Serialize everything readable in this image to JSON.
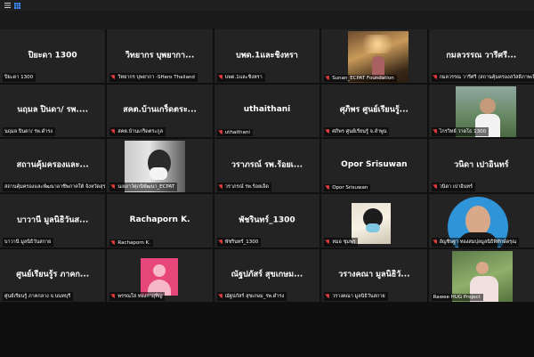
{
  "toolbar": {
    "menu_icon": "hamburger-icon",
    "grid_icon": "grid-view-icon",
    "accent": "#3b8cff"
  },
  "tiles": [
    {
      "name": "ปิยะดา 1300",
      "label": "ปิยะดา 1300",
      "muted": false
    },
    {
      "name": "วิทยากร บุพยากา...",
      "label": "วิทยากร บุพยากา -SHero Thailand",
      "muted": true
    },
    {
      "name": "บพด.1และชิงหรา",
      "label": "บพด.1และชิงหรา",
      "muted": true
    },
    {
      "name": "",
      "label": "Sunan_ECPAT Foundation",
      "muted": true,
      "video": "night"
    },
    {
      "name": "กมลวรรณ  วารีศรี...",
      "label": "กมลวรรณ  วารีศรี (สถานคุ้มครองสวัสดิภาพเป็น",
      "muted": true
    },
    {
      "name": "นฤมล ปินดา/ รพ....",
      "label": "นฤมล ปินดา/ รพ.ดำรง",
      "muted": false
    },
    {
      "name": "สคต.บ้านเกร็ดตระ...",
      "label": "สคต.บ้านเกร็ดตระกูล",
      "muted": true
    },
    {
      "name": "uthaithani",
      "label": "uthaithani",
      "muted": true
    },
    {
      "name": "ศุภิพร ศูนย์เรียนรู้...",
      "label": "ศภิพร ศูนย์เรียนรู้ จ.ลำพูน",
      "muted": true
    },
    {
      "name": "",
      "label": "ไกรวิทย์ วาดโธ 1300",
      "muted": true,
      "video": "forest"
    },
    {
      "name": "สถานคุ้มครองและ...",
      "label": "สถานคุ้มครองและพัฒนาอาชีพภาคใต้ จังหวัดสุราษ",
      "muted": false
    },
    {
      "name": "",
      "label": "นงเยาว์ศุภนิพัฒนา_ECPAT",
      "muted": true,
      "video": "mask"
    },
    {
      "name": "วราภรณ์ รพ.ร้อยเ...",
      "label": "วราภรณ์ รพ.ร้อยเอ็ด",
      "muted": true
    },
    {
      "name": "Opor Srisuwan",
      "label": "Opor Srisuwan",
      "muted": true
    },
    {
      "name": "วนิดา เปาอินทร์",
      "label": "วนิดา เปาอินทร์",
      "muted": true
    },
    {
      "name": "บาวานี มูลนิธิวันส...",
      "label": "บาวานี มูลนิธิวันสกาย",
      "muted": false
    },
    {
      "name": "Rachaporn K.",
      "label": "Rachaporn K.",
      "muted": true
    },
    {
      "name": "พัชรินทร์_1300",
      "label": "พัชรินทร์_1300",
      "muted": true
    },
    {
      "name": "",
      "label": "หมอ ชุมพร",
      "muted": true,
      "video": "selfie"
    },
    {
      "name": "",
      "label": "อัญชิษฐา ทองสมปุลมูลนิธิพิทักษ์ดรุณ",
      "muted": true,
      "video": "round"
    },
    {
      "name": "ศูนย์เรียนรู้ร ภาคก...",
      "label": "ศูนย์เรียนรู้ ภาคกลาง จ.นนทบุรี",
      "muted": false
    },
    {
      "name": "",
      "label": "พรรณใส ทองกายุทิญ",
      "muted": true,
      "video": "pink"
    },
    {
      "name": "ณัฐปภัสร์ สุขเกษม...",
      "label": "ณัฐปภัสร์ สุขเกษม_รพ.ดำรง",
      "muted": true
    },
    {
      "name": "วรางคณา มูลนิธิวั...",
      "label": "วรางคณา มูลนิธิวันสกาย",
      "muted": true
    },
    {
      "name": "",
      "label": "Rawee HUG Project",
      "muted": false,
      "video": "green"
    }
  ]
}
